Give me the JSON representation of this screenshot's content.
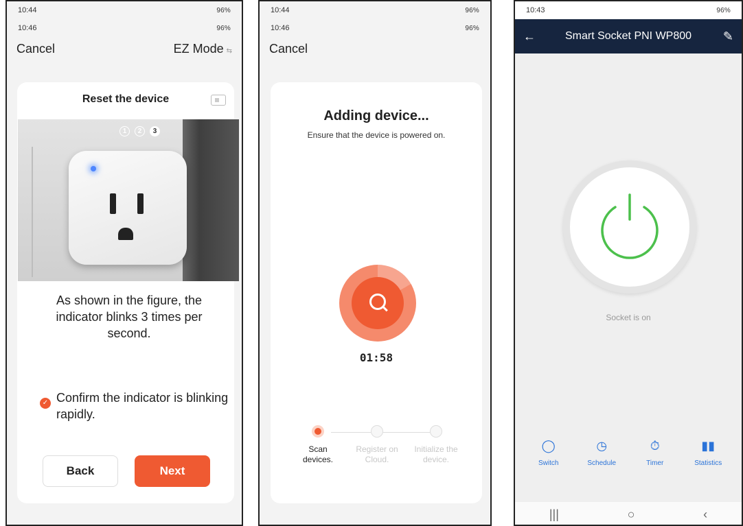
{
  "panel1": {
    "status_top": {
      "time": "10:44",
      "right": "96%"
    },
    "status_second": {
      "time": "10:46",
      "right": "96%"
    },
    "cancel": "Cancel",
    "ez_mode": "EZ Mode",
    "card_title": "Reset the device",
    "step_numbers": [
      "1",
      "2",
      "3"
    ],
    "description": "As shown in the figure, the indicator blinks 3 times per second.",
    "confirm_text": "Confirm the indicator is blinking rapidly.",
    "back_label": "Back",
    "next_label": "Next",
    "colors": {
      "accent": "#ef5a32"
    }
  },
  "panel2": {
    "status_top": {
      "time": "10:44",
      "right": "96%"
    },
    "status_second": {
      "time": "10:46",
      "right": "96%"
    },
    "cancel": "Cancel",
    "title": "Adding device...",
    "subtitle": "Ensure that the device is powered on.",
    "timer": "01:58",
    "steps": [
      {
        "label": "Scan devices.",
        "state": "active"
      },
      {
        "label": "Register on Cloud.",
        "state": "pending"
      },
      {
        "label": "Initialize the device.",
        "state": "pending"
      }
    ]
  },
  "panel3": {
    "status": {
      "time": "10:43",
      "right": "96%"
    },
    "title": "Smart Socket PNI WP800",
    "socket_status": "Socket is on",
    "tabs": [
      {
        "label": "Switch",
        "icon": "switch-icon"
      },
      {
        "label": "Schedule",
        "icon": "clock-icon"
      },
      {
        "label": "Timer",
        "icon": "stopwatch-icon"
      },
      {
        "label": "Statistics",
        "icon": "bar-chart-icon"
      }
    ],
    "colors": {
      "header": "#16253f",
      "power": "#4cc04c",
      "tabs": "#2b73d8"
    }
  }
}
